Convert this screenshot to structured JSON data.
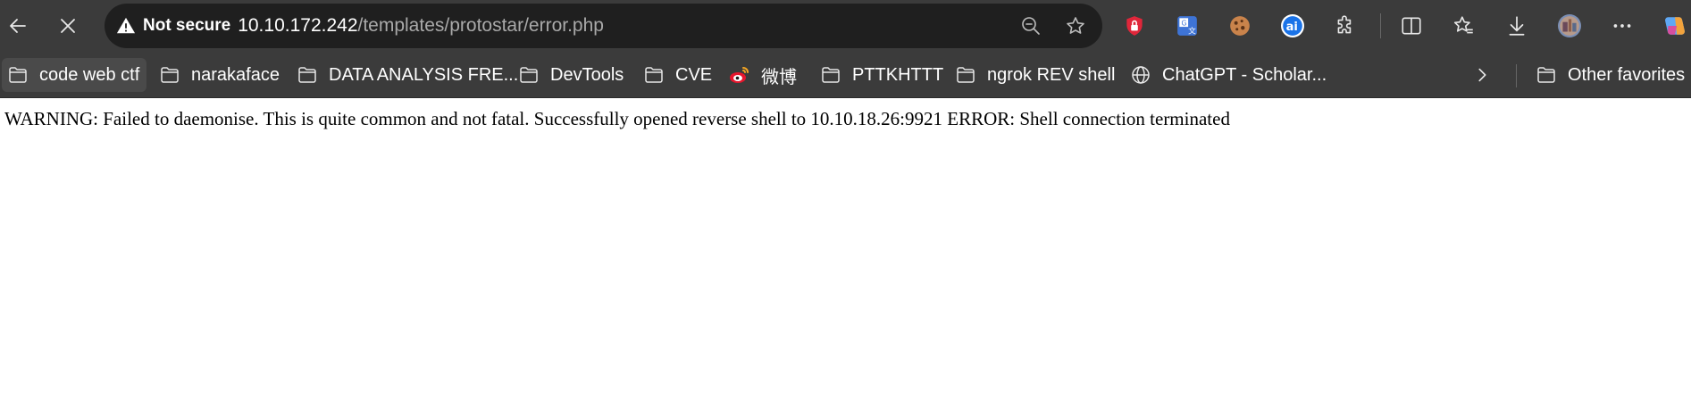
{
  "browser": {
    "security_label": "Not secure",
    "url_host": "10.10.172.242",
    "url_path": "/templates/protostar/error.php",
    "icons": {
      "back": "arrow-left-icon",
      "stop": "close-icon",
      "warning": "warning-triangle-icon",
      "zoom": "zoom-out-icon",
      "favorite": "star-icon"
    },
    "extensions": [
      {
        "name": "shield-lock-icon",
        "color": "#e0263a"
      },
      {
        "name": "translate-icon",
        "color": "#3e74d6"
      },
      {
        "name": "cookie-icon",
        "color": "#c9834b"
      },
      {
        "name": "ai-extension-icon",
        "color": "#1a73e8"
      },
      {
        "name": "puzzle-icon",
        "color": "#e8e8e8"
      },
      {
        "name": "split-screen-icon",
        "color": "#e8e8e8"
      },
      {
        "name": "favorites-icon",
        "color": "#e8e8e8"
      },
      {
        "name": "download-icon",
        "color": "#e8e8e8"
      },
      {
        "name": "profile-avatar",
        "color": "#8a6f8f"
      },
      {
        "name": "more-options-icon",
        "color": "#e8e8e8"
      },
      {
        "name": "copilot-icon",
        "color": "#5fa8f5"
      }
    ]
  },
  "bookmarks": [
    {
      "label": "code web ctf",
      "icon": "folder-icon"
    },
    {
      "label": "narakaface",
      "icon": "folder-icon"
    },
    {
      "label": "DATA ANALYSIS FRE...",
      "icon": "folder-icon"
    },
    {
      "label": "DevTools",
      "icon": "folder-icon"
    },
    {
      "label": "CVE",
      "icon": "folder-icon"
    },
    {
      "label": "微博",
      "icon": "weibo-icon"
    },
    {
      "label": "PTTKHTTT",
      "icon": "folder-icon"
    },
    {
      "label": "ngrok REV shell",
      "icon": "folder-icon"
    },
    {
      "label": "ChatGPT - Scholar...",
      "icon": "globe-icon"
    },
    {
      "label": "Other favorites",
      "icon": "folder-icon"
    }
  ],
  "page": {
    "body_text": "WARNING: Failed to daemonise. This is quite common and not fatal. Successfully opened reverse shell to 10.10.18.26:9921 ERROR: Shell connection terminated"
  }
}
